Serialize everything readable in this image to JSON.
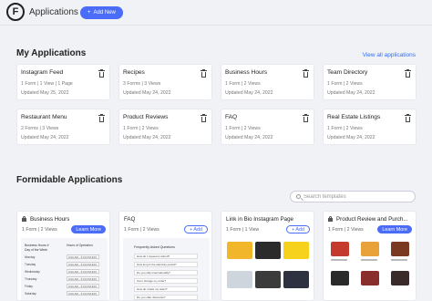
{
  "header": {
    "logo_letter": "F",
    "title": "Applications",
    "add_new_label": "Add New",
    "add_new_icon": "plus-icon"
  },
  "my_applications": {
    "title": "My Applications",
    "view_all_label": "View all applications",
    "cards": [
      {
        "title": "Instagram Feed",
        "meta": "1 Form | 1 View | 1 Page",
        "updated": "Updated May 25, 2022"
      },
      {
        "title": "Recipes",
        "meta": "3 Forms | 3 Views",
        "updated": "Updated May 24, 2022"
      },
      {
        "title": "Business Hours",
        "meta": "1 Form | 2 Views",
        "updated": "Updated May 24, 2022"
      },
      {
        "title": "Team Directory",
        "meta": "1 Form | 2 Views",
        "updated": "Updated May 24, 2022"
      },
      {
        "title": "Restaurant Menu",
        "meta": "2 Forms | 3 Views",
        "updated": "Updated May 24, 2022"
      },
      {
        "title": "Product Reviews",
        "meta": "1 Form | 2 Views",
        "updated": "Updated May 24, 2022"
      },
      {
        "title": "FAQ",
        "meta": "1 Form | 2 Views",
        "updated": "Updated May 24, 2022"
      },
      {
        "title": "Real Estate Listings",
        "meta": "1 Form | 2 Views",
        "updated": "Updated May 24, 2022"
      }
    ]
  },
  "formidable_applications": {
    "title": "Formidable Applications",
    "search_placeholder": "Search templates",
    "templates": [
      {
        "title": "Business Hours",
        "meta": "1 Form | 2 Views",
        "action": "Learn More",
        "locked": true
      },
      {
        "title": "FAQ",
        "meta": "1 Form | 2 Views",
        "action": "+ Add",
        "locked": false
      },
      {
        "title": "Link in Bio Instagram Page",
        "meta": "1 Form | 1 View",
        "action": "+ Add",
        "locked": false
      },
      {
        "title": "Product Review and Purch...",
        "meta": "1 Form | 2 Views",
        "action": "Learn More",
        "locked": true
      }
    ],
    "hours_preview": {
      "title": "Business Hours #",
      "col1": "Day of the Week",
      "col2": "Hours of Operation",
      "days": [
        "Monday",
        "Tuesday",
        "Wednesday",
        "Thursday",
        "Friday",
        "Saturday"
      ],
      "times": [
        "9:00 AM - 5:00 PM EST",
        "9:00 AM - 5:00 PM EST",
        "9:00 AM - 5:00 PM EST",
        "9:00 AM - 5:00 PM EST",
        "9:00 AM - 5:00 PM EST",
        "9:00 AM - 5:00 PM EST"
      ]
    },
    "faq_preview": {
      "title": "Frequently Asked Questions",
      "questions": [
        "How do I request a refund?",
        "How long is the warranty period?",
        "Do you ship internationally?",
        "Can I change my order?",
        "How do I track my order?",
        "Do you offer discounts?"
      ]
    }
  },
  "colors": {
    "accent": "#4a6cf7",
    "link": "#2f6df4",
    "background": "#f1f2f6"
  }
}
